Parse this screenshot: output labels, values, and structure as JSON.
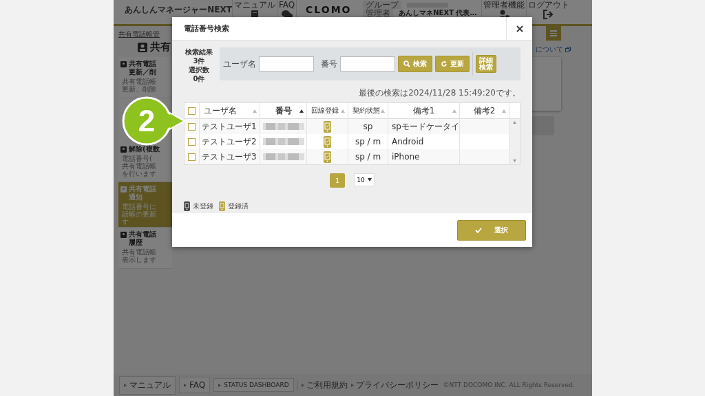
{
  "app_header": {
    "logo": "あんしんマネージャーNEXT",
    "nav": [
      {
        "label": "マニュアル",
        "kind": "manual"
      },
      {
        "label": "FAQ",
        "kind": "faq"
      }
    ],
    "brand": "CLOMO",
    "group_label": "グループ",
    "admin_label": "管理者",
    "admin_name": "あんしマネNEXT 代表…",
    "actions": [
      {
        "label": "管理者機能",
        "kind": "admin"
      },
      {
        "label": "ログアウト",
        "kind": "logout"
      }
    ]
  },
  "breadcrumb": "共有電話帳管",
  "page_title": "共有",
  "sidebar": {
    "items": [
      {
        "title": [
          "共有電話",
          "更新／削"
        ],
        "desc": [
          "共有電話帳",
          "更新、削除"
        ],
        "selected": false
      },
      {
        "title": [
          "解除(複数"
        ],
        "desc": [
          "電話番号(",
          "共有電話帳",
          "を行います"
        ],
        "selected": false
      },
      {
        "title": [
          "共有電話",
          "通知"
        ],
        "desc": [
          "電話番号に",
          "話帳の更新",
          "す"
        ],
        "selected": true
      },
      {
        "title": [
          "共有電話",
          "履歴"
        ],
        "desc": [
          "共有電話帳",
          "表示します"
        ],
        "selected": false
      }
    ]
  },
  "help_link": "について",
  "footer": {
    "buttons": [
      "マニュアル",
      "FAQ",
      "STATUS DASHBOARD"
    ],
    "links": [
      "ご利用規約",
      "プライバシーポリシー"
    ],
    "copyright": "©NTT DOCOMO INC. ALL Rights Reserved."
  },
  "dialog": {
    "title": "電話番号検索",
    "result_label": "検索結果",
    "result_count": "3件",
    "selected_label": "選択数",
    "selected_count": "0件",
    "search": {
      "user_label": "ユーザ名",
      "number_label": "番号",
      "buttons": [
        {
          "label": "検索",
          "kind": "search"
        },
        {
          "label": "更新",
          "kind": "refresh"
        },
        {
          "label": "詳細検索",
          "kind": "detail"
        }
      ]
    },
    "last_search": "最後の検索は2024/11/28 15:49:20です。",
    "table": {
      "all_checked": false,
      "columns": [
        {
          "label": "ユーザ名",
          "sorted": false
        },
        {
          "label": "番号",
          "sorted": true
        },
        {
          "label": "回線登録",
          "sorted": false
        },
        {
          "label": "契約状態",
          "sorted": false
        },
        {
          "label": "備考1",
          "sorted": false
        },
        {
          "label": "備考2",
          "sorted": false
        }
      ],
      "rows": [
        {
          "checked": false,
          "user": "テストユーザ1",
          "registered": true,
          "contract": "sp",
          "note1": "spモードケータイ"
        },
        {
          "checked": false,
          "user": "テストユーザ2",
          "registered": true,
          "contract": "sp / m",
          "note1": "Android"
        },
        {
          "checked": false,
          "user": "テストユーザ3",
          "registered": true,
          "contract": "sp / m",
          "note1": "iPhone"
        }
      ]
    },
    "pagination": {
      "pages": [
        {
          "label": "1",
          "selected": true
        }
      ],
      "page_size": "10"
    },
    "legend": [
      {
        "label": "未登録",
        "registered": false
      },
      {
        "label": "登録済",
        "registered": true
      }
    ],
    "select_button": "選択"
  },
  "callout": {
    "number": "2"
  }
}
